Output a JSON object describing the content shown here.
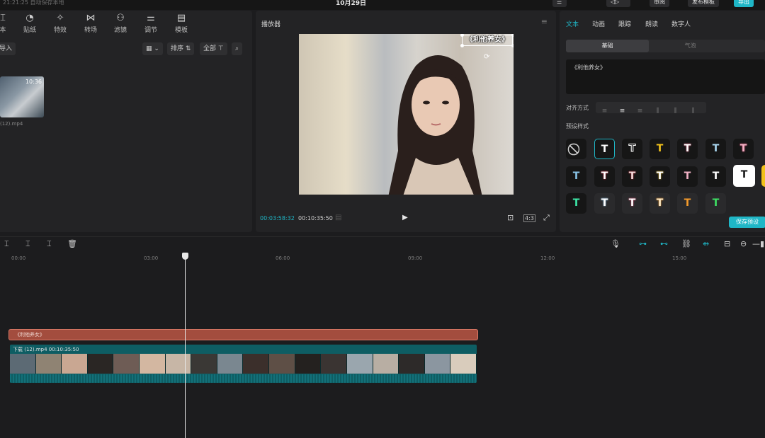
{
  "topbar": {
    "autosave": "21:21:25 自动保存本地",
    "date": "10月29日",
    "buttons": [
      "审阅",
      "发布模板",
      "导出"
    ]
  },
  "media": {
    "tools": [
      {
        "icon": "text-icon",
        "label": "本"
      },
      {
        "icon": "sticker-icon",
        "label": "贴纸"
      },
      {
        "icon": "effects-icon",
        "label": "特效"
      },
      {
        "icon": "transition-icon",
        "label": "转场"
      },
      {
        "icon": "filter-icon",
        "label": "滤镜"
      },
      {
        "icon": "adjust-icon",
        "label": "调节"
      },
      {
        "icon": "template-icon",
        "label": "模板"
      }
    ],
    "import_label": "导入",
    "sort_label": "排序",
    "all_label": "全部",
    "clip": {
      "duration": "10:36",
      "filename": "(12).mp4"
    }
  },
  "player": {
    "title": "播放器",
    "overlay_text": "《利他养女》",
    "current_time": "00:03:58:32",
    "total_time": "00:10:35:50",
    "ratio": "4:3"
  },
  "props": {
    "tabs": [
      "文本",
      "动画",
      "跟踪",
      "朗读",
      "数字人"
    ],
    "active_tab": "文本",
    "segment_on": "基础",
    "segment_off": "气泡",
    "text_value": "《利他养女》",
    "align_label": "对齐方式",
    "preset_label": "预设样式",
    "save_preset": "保存预设"
  },
  "timeline": {
    "ticks": [
      "00:00",
      "03:00",
      "06:00",
      "09:00",
      "12:00",
      "15:00"
    ],
    "text_clip": "《利他养女》",
    "video_clip_name": "下载 (12).mp4",
    "video_clip_duration": "00:10:35:50"
  }
}
